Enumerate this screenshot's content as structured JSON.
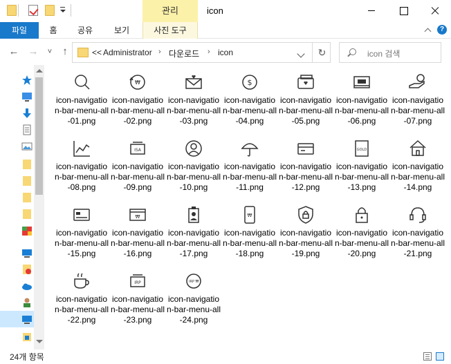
{
  "titlebar": {
    "context_group": "관리",
    "title": "icon"
  },
  "ribbon": {
    "file_tab": "파일",
    "tabs": [
      "홈",
      "공유",
      "보기"
    ],
    "context_tab": "사진 도구",
    "help_icon": "?"
  },
  "nav": {
    "back": "←",
    "forward": "→",
    "recent": "˅",
    "up": "↑"
  },
  "address": {
    "overflow": "<<",
    "segments": [
      "Administrator",
      "다운로드",
      "icon"
    ],
    "refresh": "↻"
  },
  "search": {
    "placeholder": "icon 검색"
  },
  "files": [
    {
      "name": "icon-navigation-bar-menu-all-01.png",
      "icon": "search-icon"
    },
    {
      "name": "icon-navigation-bar-menu-all-02.png",
      "icon": "won-transfer-icon"
    },
    {
      "name": "icon-navigation-bar-menu-all-03.png",
      "icon": "envelope-heart-icon"
    },
    {
      "name": "icon-navigation-bar-menu-all-04.png",
      "icon": "coin-icon"
    },
    {
      "name": "icon-navigation-bar-menu-all-05.png",
      "icon": "wallet-heart-icon"
    },
    {
      "name": "icon-navigation-bar-menu-all-06.png",
      "icon": "card-reader-icon"
    },
    {
      "name": "icon-navigation-bar-menu-all-07.png",
      "icon": "hand-coin-icon"
    },
    {
      "name": "icon-navigation-bar-menu-all-08.png",
      "icon": "line-chart-icon"
    },
    {
      "name": "icon-navigation-bar-menu-all-09.png",
      "icon": "isa-account-icon"
    },
    {
      "name": "icon-navigation-bar-menu-all-10.png",
      "icon": "user-icon"
    },
    {
      "name": "icon-navigation-bar-menu-all-11.png",
      "icon": "umbrella-icon"
    },
    {
      "name": "icon-navigation-bar-menu-all-12.png",
      "icon": "credit-card-icon"
    },
    {
      "name": "icon-navigation-bar-menu-all-13.png",
      "icon": "gold-icon"
    },
    {
      "name": "icon-navigation-bar-menu-all-14.png",
      "icon": "home-icon"
    },
    {
      "name": "icon-navigation-bar-menu-all-15.png",
      "icon": "card-icon"
    },
    {
      "name": "icon-navigation-bar-menu-all-16.png",
      "icon": "won-card-icon"
    },
    {
      "name": "icon-navigation-bar-menu-all-17.png",
      "icon": "id-badge-icon"
    },
    {
      "name": "icon-navigation-bar-menu-all-18.png",
      "icon": "mobile-won-icon"
    },
    {
      "name": "icon-navigation-bar-menu-all-19.png",
      "icon": "shield-icon"
    },
    {
      "name": "icon-navigation-bar-menu-all-20.png",
      "icon": "lock-icon"
    },
    {
      "name": "icon-navigation-bar-menu-all-21.png",
      "icon": "headset-icon"
    },
    {
      "name": "icon-navigation-bar-menu-all-22.png",
      "icon": "coffee-icon"
    },
    {
      "name": "icon-navigation-bar-menu-all-23.png",
      "icon": "irp-account-icon"
    },
    {
      "name": "icon-navigation-bar-menu-all-24.png",
      "icon": "irp-won-icon"
    }
  ],
  "status": {
    "count": "24개 항목"
  }
}
